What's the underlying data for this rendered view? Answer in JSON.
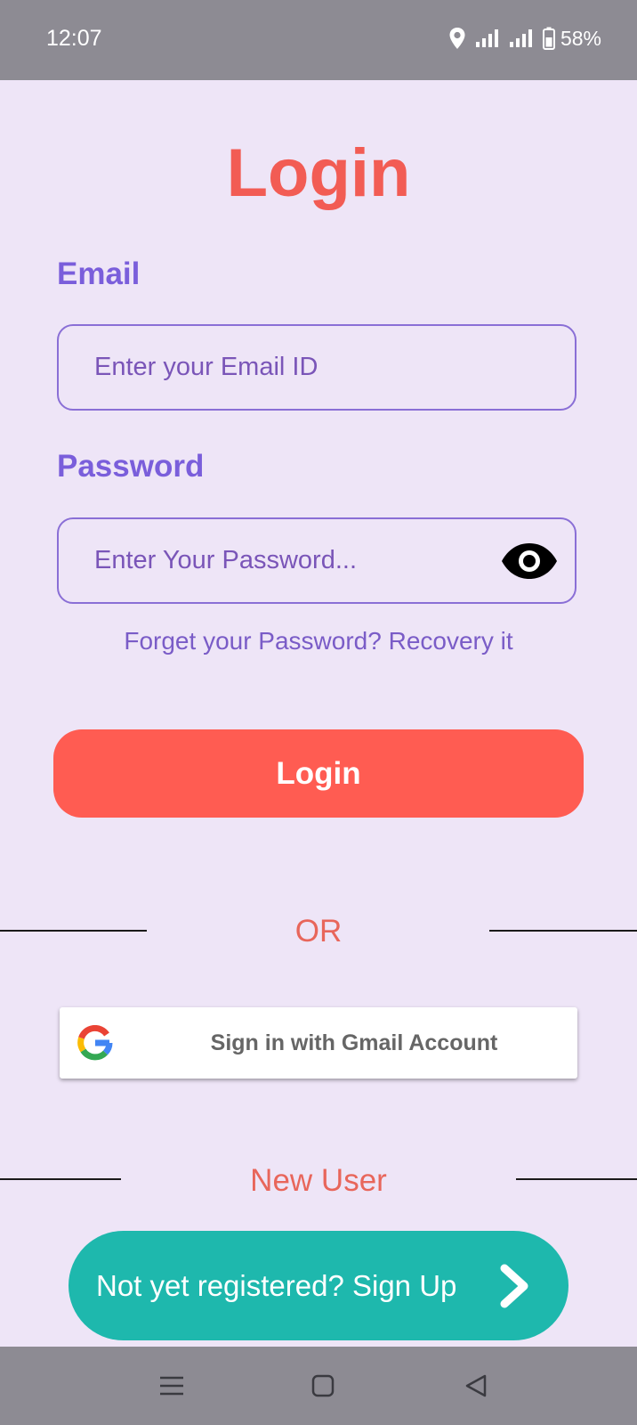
{
  "status_bar": {
    "time": "12:07",
    "battery": "58%",
    "icons": [
      "location-icon",
      "signal-icon",
      "signal-icon",
      "battery-icon"
    ]
  },
  "login": {
    "title": "Login",
    "email_label": "Email",
    "email_placeholder": "Enter your Email ID",
    "password_label": "Password",
    "password_placeholder": "Enter Your Password...",
    "password_toggle_icon": "eye-icon",
    "forgot_text": "Forget your Password? Recovery it",
    "button_label": "Login",
    "or_text": "OR",
    "google_button_label": "Sign in with Gmail Account",
    "google_icon": "google-icon",
    "new_user_text": "New User",
    "signup_label": "Not yet registered? Sign Up",
    "signup_icon": "chevron-right-icon"
  },
  "nav_bar": {
    "buttons": [
      "menu-icon",
      "home-icon",
      "back-icon"
    ]
  },
  "colors": {
    "background": "#EEE5F7",
    "system_bar": "#8D8B93",
    "title": "#F25C54",
    "label": "#7A5EDB",
    "input_border": "#8A6FD6",
    "input_text": "#7A55B8",
    "link": "#7A5CC7",
    "login_button": "#FF5C52",
    "accent_text": "#E8665B",
    "signup_button": "#1EB8AD"
  }
}
